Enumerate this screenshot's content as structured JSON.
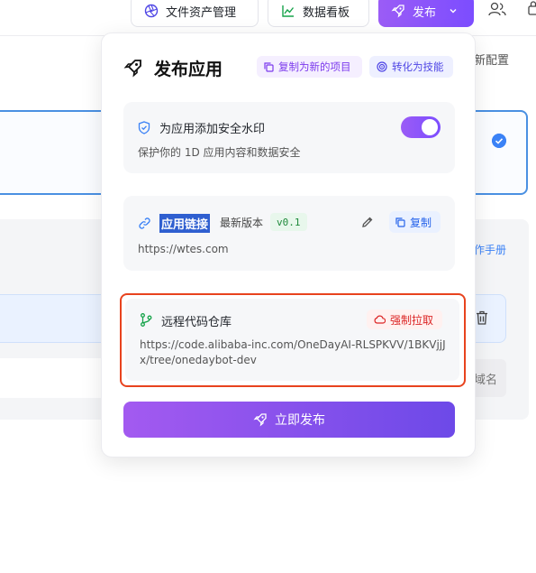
{
  "topbar": {
    "assets_label": "文件资产管理",
    "dashboard_label": "数据看板",
    "publish_label": "发布"
  },
  "background": {
    "config_label": "新配置",
    "manual_label": "作手册",
    "name_label": "域名"
  },
  "popover": {
    "title": "发布应用",
    "copy_project_label": "复制为新的项目",
    "to_skill_label": "转化为技能",
    "watermark": {
      "title": "为应用添加安全水印",
      "description": "保护你的 1D 应用内容和数据安全",
      "enabled": true
    },
    "app_link": {
      "title": "应用链接",
      "version_label": "最新版本",
      "version": "v0.1",
      "copy_label": "复制",
      "url": "https://wtes.com"
    },
    "repo": {
      "title": "远程代码仓库",
      "force_pull_label": "强制拉取",
      "url": "https://code.alibaba-inc.com/OneDayAI-RLSPKVV/1BKVjjJx/tree/onedaybot-dev"
    },
    "publish_now_label": "立即发布"
  },
  "colors": {
    "accent": "#7c4dff",
    "highlight_border": "#e8431e",
    "link_blue": "#2563eb"
  }
}
